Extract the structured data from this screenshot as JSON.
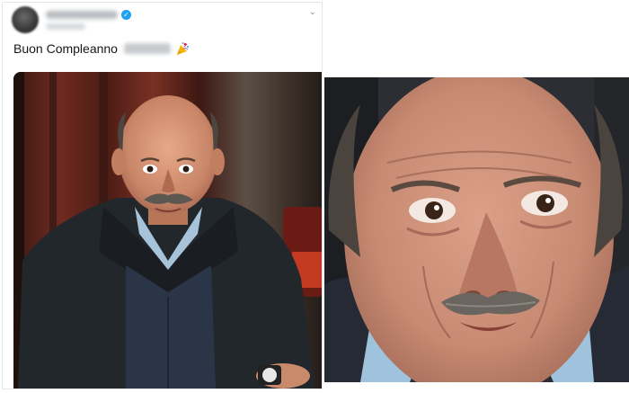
{
  "tweet": {
    "text": "Buon Compleanno",
    "verified_icon": "verified-badge-icon",
    "menu_icon": "chevron-down-icon",
    "emoji": "party-popper-icon"
  },
  "media": {
    "primary_image": "photo-man-seated-in-studio",
    "secondary_image": "photo-man-face-closeup"
  },
  "colors": {
    "verified": "#1da1f2",
    "text": "#14171a",
    "card_border": "#e1e8ed"
  }
}
